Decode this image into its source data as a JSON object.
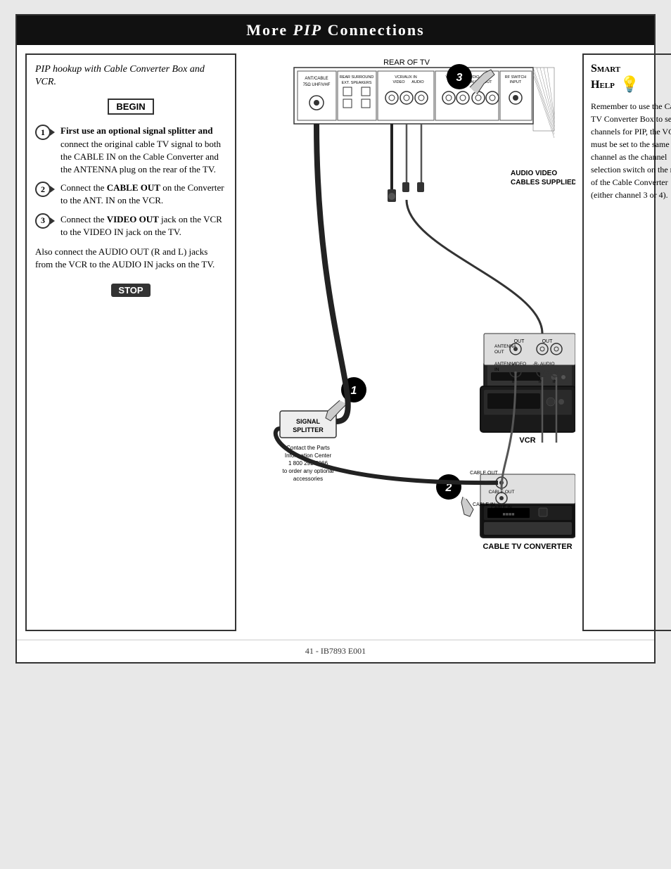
{
  "header": {
    "title": "More PIP Connections",
    "more": "More ",
    "pip": "PIP",
    "connections": " Connections"
  },
  "instructions": {
    "title": "PIP hookup with Cable Converter Box and VCR.",
    "begin_label": "BEGIN",
    "stop_label": "STOP",
    "steps": [
      {
        "number": "1",
        "text": "First use an optional signal splitter and connect the original cable TV signal to both the CABLE IN on the Cable Converter and the ANTENNA plug on the rear of the TV."
      },
      {
        "number": "2",
        "text": "Connect the CABLE OUT on the Converter to the ANT. IN on the VCR."
      },
      {
        "number": "3",
        "text": "Connect the VIDEO OUT jack on the VCR to the VIDEO IN jack on the TV."
      }
    ],
    "additional": "Also connect the AUDIO OUT (R and L) jacks from the VCR to the AUDIO IN jacks on the TV."
  },
  "smart_help": {
    "title_line1": "Smart",
    "title_line2": "Help",
    "body": "Remember to use the Cable TV Converter Box to select channels for PIP, the VCR must be set to the same channel as the channel selection switch on the rear of the Cable Converter (either channel 3 or 4)."
  },
  "diagram": {
    "rear_of_tv_label": "REAR OF TV",
    "audio_video_cables_label": "AUDIO VIDEO\nCABLES SUPPLIED",
    "signal_splitter_label": "SIGNAL\nSPLITTER",
    "contact_info": "Contact the Parts\nInformation Center\n1 800 292-6066\nto order any optional\naccessories",
    "vcr_label": "VCR",
    "cable_tv_converter_label": "CABLE TV CONVERTER",
    "cable_out_label": "CABLE OUT",
    "cable_in_label": "CABLE IN",
    "antenna_out_label": "ANTENNA\nOUT",
    "antenna_in_label": "ANTENNA\nIN",
    "video_label": "VIDEO",
    "audio_label": "-R- AUDIO",
    "out_label": "OUT",
    "in_label": "IN"
  },
  "footer": {
    "text": "41 - IB7893 E001"
  }
}
